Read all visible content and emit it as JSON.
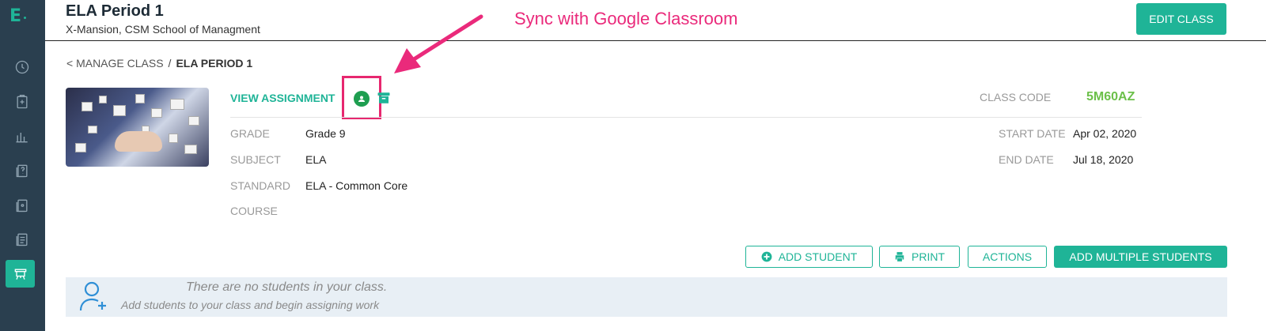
{
  "app": {
    "logo": "E"
  },
  "header": {
    "title": "ELA Period 1",
    "subtitle": "X-Mansion, CSM School of Managment",
    "edit_button": "EDIT CLASS"
  },
  "annotation": {
    "text": "Sync with Google Classroom",
    "color": "#ea2a7b"
  },
  "breadcrumb": {
    "back": "< MANAGE CLASS",
    "separator": "/",
    "current": "ELA PERIOD 1"
  },
  "details": {
    "view_assignment": "VIEW ASSIGNMENT",
    "class_code_label": "CLASS CODE",
    "class_code": "5M60AZ",
    "rows": [
      {
        "label": "GRADE",
        "value": "Grade 9"
      },
      {
        "label": "SUBJECT",
        "value": "ELA"
      },
      {
        "label": "STANDARD",
        "value": "ELA - Common Core"
      },
      {
        "label": "COURSE",
        "value": ""
      }
    ],
    "dates": [
      {
        "label": "START DATE",
        "value": "Apr 02, 2020"
      },
      {
        "label": "END DATE",
        "value": "Jul 18, 2020"
      }
    ]
  },
  "actions": {
    "add_student": "ADD STUDENT",
    "print": "PRINT",
    "actions": "ACTIONS",
    "add_multiple": "ADD MULTIPLE STUDENTS"
  },
  "empty_state": {
    "title": "There are no students in your class.",
    "subtitle": "Add students to your class and begin assigning work"
  },
  "sidebar": {
    "items": [
      {
        "icon": "dashboard-icon"
      },
      {
        "icon": "assignments-icon"
      },
      {
        "icon": "reports-icon"
      },
      {
        "icon": "question-bank-icon"
      },
      {
        "icon": "content-icon"
      },
      {
        "icon": "documents-icon"
      },
      {
        "icon": "classroom-icon",
        "active": true
      }
    ]
  },
  "colors": {
    "accent": "#1fb497",
    "sidebar": "#2a3f4f",
    "code": "#6cc04a",
    "google": "#1e9e50"
  }
}
